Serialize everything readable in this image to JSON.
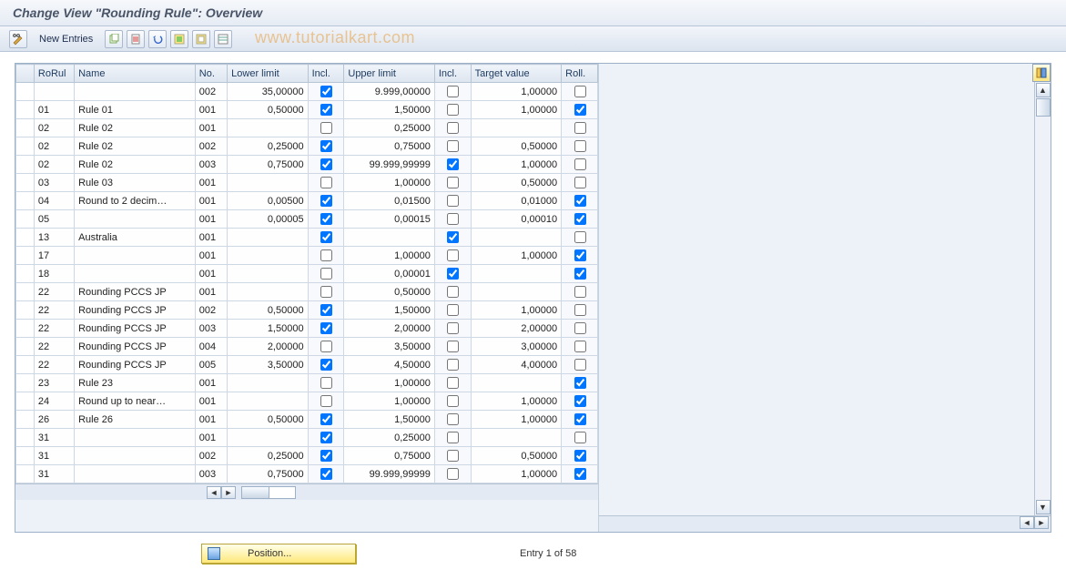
{
  "title": "Change View \"Rounding Rule\": Overview",
  "watermark": "www.tutorialkart.com",
  "toolbar": {
    "new_entries_label": "New Entries"
  },
  "columns": {
    "rorul": "RoRul",
    "name": "Name",
    "no": "No.",
    "lower": "Lower limit",
    "incl1": "Incl.",
    "upper": "Upper limit",
    "incl2": "Incl.",
    "target": "Target value",
    "roll": "Roll."
  },
  "footer": {
    "position_label": "Position...",
    "entry_label": "Entry 1 of 58"
  },
  "rows": [
    {
      "rorul": "",
      "name": "",
      "no": "002",
      "lower": "35,00000",
      "incl1": true,
      "upper": "9.999,00000",
      "incl2": false,
      "target": "1,00000",
      "roll": false
    },
    {
      "rorul": "01",
      "name": "Rule 01",
      "no": "001",
      "lower": "0,50000",
      "incl1": true,
      "upper": "1,50000",
      "incl2": false,
      "target": "1,00000",
      "roll": true
    },
    {
      "rorul": "02",
      "name": "Rule 02",
      "no": "001",
      "lower": "",
      "incl1": false,
      "upper": "0,25000",
      "incl2": false,
      "target": "",
      "roll": false
    },
    {
      "rorul": "02",
      "name": "Rule 02",
      "no": "002",
      "lower": "0,25000",
      "incl1": true,
      "upper": "0,75000",
      "incl2": false,
      "target": "0,50000",
      "roll": false
    },
    {
      "rorul": "02",
      "name": "Rule 02",
      "no": "003",
      "lower": "0,75000",
      "incl1": true,
      "upper": "99.999,99999",
      "incl2": true,
      "target": "1,00000",
      "roll": false
    },
    {
      "rorul": "03",
      "name": "Rule 03",
      "no": "001",
      "lower": "",
      "incl1": false,
      "upper": "1,00000",
      "incl2": false,
      "target": "0,50000",
      "roll": false
    },
    {
      "rorul": "04",
      "name": "Round to 2 decim…",
      "no": "001",
      "lower": "0,00500",
      "incl1": true,
      "upper": "0,01500",
      "incl2": false,
      "target": "0,01000",
      "roll": true
    },
    {
      "rorul": "05",
      "name": "",
      "no": "001",
      "lower": "0,00005",
      "incl1": true,
      "upper": "0,00015",
      "incl2": false,
      "target": "0,00010",
      "roll": true
    },
    {
      "rorul": "13",
      "name": "Australia",
      "no": "001",
      "lower": "",
      "incl1": true,
      "upper": "",
      "incl2": true,
      "target": "",
      "roll": false
    },
    {
      "rorul": "17",
      "name": "",
      "no": "001",
      "lower": "",
      "incl1": false,
      "upper": "1,00000",
      "incl2": false,
      "target": "1,00000",
      "roll": true
    },
    {
      "rorul": "18",
      "name": "",
      "no": "001",
      "lower": "",
      "incl1": false,
      "upper": "0,00001",
      "incl2": true,
      "target": "",
      "roll": true
    },
    {
      "rorul": "22",
      "name": "Rounding PCCS JP",
      "no": "001",
      "lower": "",
      "incl1": false,
      "upper": "0,50000",
      "incl2": false,
      "target": "",
      "roll": false
    },
    {
      "rorul": "22",
      "name": "Rounding PCCS JP",
      "no": "002",
      "lower": "0,50000",
      "incl1": true,
      "upper": "1,50000",
      "incl2": false,
      "target": "1,00000",
      "roll": false
    },
    {
      "rorul": "22",
      "name": "Rounding PCCS JP",
      "no": "003",
      "lower": "1,50000",
      "incl1": true,
      "upper": "2,00000",
      "incl2": false,
      "target": "2,00000",
      "roll": false
    },
    {
      "rorul": "22",
      "name": "Rounding PCCS JP",
      "no": "004",
      "lower": "2,00000",
      "incl1": false,
      "upper": "3,50000",
      "incl2": false,
      "target": "3,00000",
      "roll": false
    },
    {
      "rorul": "22",
      "name": "Rounding PCCS JP",
      "no": "005",
      "lower": "3,50000",
      "incl1": true,
      "upper": "4,50000",
      "incl2": false,
      "target": "4,00000",
      "roll": false
    },
    {
      "rorul": "23",
      "name": "Rule 23",
      "no": "001",
      "lower": "",
      "incl1": false,
      "upper": "1,00000",
      "incl2": false,
      "target": "",
      "roll": true
    },
    {
      "rorul": "24",
      "name": "Round up to near…",
      "no": "001",
      "lower": "",
      "incl1": false,
      "upper": "1,00000",
      "incl2": false,
      "target": "1,00000",
      "roll": true
    },
    {
      "rorul": "26",
      "name": "Rule 26",
      "no": "001",
      "lower": "0,50000",
      "incl1": true,
      "upper": "1,50000",
      "incl2": false,
      "target": "1,00000",
      "roll": true
    },
    {
      "rorul": "31",
      "name": "",
      "no": "001",
      "lower": "",
      "incl1": true,
      "upper": "0,25000",
      "incl2": false,
      "target": "",
      "roll": false
    },
    {
      "rorul": "31",
      "name": "",
      "no": "002",
      "lower": "0,25000",
      "incl1": true,
      "upper": "0,75000",
      "incl2": false,
      "target": "0,50000",
      "roll": true
    },
    {
      "rorul": "31",
      "name": "",
      "no": "003",
      "lower": "0,75000",
      "incl1": true,
      "upper": "99.999,99999",
      "incl2": false,
      "target": "1,00000",
      "roll": true
    }
  ]
}
